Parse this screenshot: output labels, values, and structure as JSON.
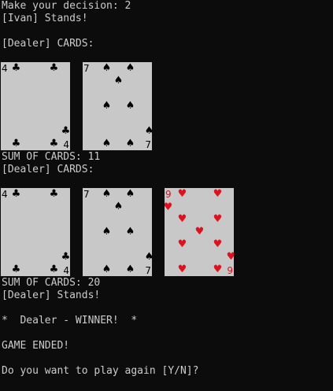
{
  "console": {
    "lines": [
      "Make your decision: 2",
      "[Ivan] Stands!",
      "[Dealer] CARDS:",
      "SUM OF CARDS: 11",
      "[Dealer] CARDS:",
      "SUM OF CARDS: 20",
      "[Dealer] Stands!",
      "*  Dealer - WINNER!  *",
      "GAME ENDED!",
      "Do you want to play again [Y/N]?"
    ]
  },
  "hands": [
    {
      "cards": [
        {
          "rank": "4",
          "suit": "♣",
          "suit_name": "clubs",
          "color": "black"
        },
        {
          "rank": "7",
          "suit": "♠",
          "suit_name": "spades",
          "color": "black"
        }
      ]
    },
    {
      "cards": [
        {
          "rank": "4",
          "suit": "♣",
          "suit_name": "clubs",
          "color": "black"
        },
        {
          "rank": "7",
          "suit": "♠",
          "suit_name": "spades",
          "color": "black"
        },
        {
          "rank": "9",
          "suit": "♥",
          "suit_name": "hearts",
          "color": "red"
        }
      ]
    }
  ],
  "colors": {
    "background": "#0c0c0c",
    "text": "#cccccc",
    "card_face": "#c8c8c8",
    "red_suit": "#e0101e",
    "black_suit": "#000000"
  }
}
